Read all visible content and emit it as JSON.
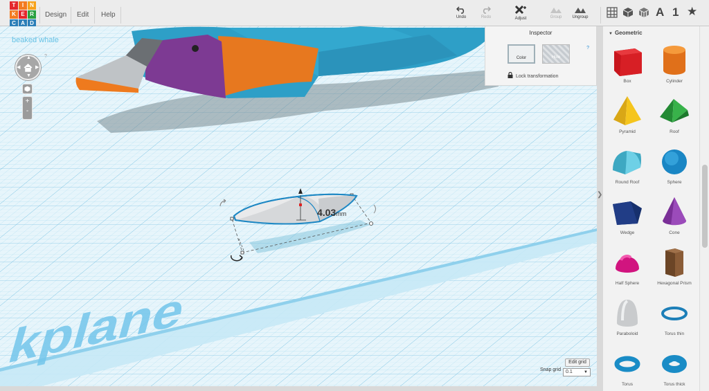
{
  "logo": {
    "letters": [
      "T",
      "I",
      "N",
      "K",
      "E",
      "R",
      "C",
      "A",
      "D"
    ]
  },
  "menu": {
    "design": "Design",
    "edit": "Edit",
    "help": "Help"
  },
  "toolbar": {
    "undo": "Undo",
    "redo": "Redo",
    "adjust": "Adjust",
    "group": "Group",
    "ungroup": "Ungroup"
  },
  "right_tools": {
    "text": "A",
    "number": "1",
    "favorites": "★"
  },
  "document": {
    "title": "beaked whale",
    "help": "?"
  },
  "workplane": {
    "label": "kplane"
  },
  "dimension": {
    "value": "4.03",
    "unit": "mm"
  },
  "grid": {
    "edit_label": "Edit grid",
    "snap_label": "Snap grid",
    "snap_value": "0.1"
  },
  "inspector": {
    "title": "Inspector",
    "color_label": "Color",
    "hole_label": "Hole",
    "help": "?",
    "lock_label": "Lock transformation"
  },
  "panel": {
    "title": "Geometric",
    "shapes": [
      {
        "label": "Box",
        "icon": "box-icon"
      },
      {
        "label": "Cylinder",
        "icon": "cylinder-icon"
      },
      {
        "label": "Pyramid",
        "icon": "pyramid-icon"
      },
      {
        "label": "Roof",
        "icon": "roof-icon"
      },
      {
        "label": "Round Roof",
        "icon": "round-roof-icon"
      },
      {
        "label": "Sphere",
        "icon": "sphere-icon"
      },
      {
        "label": "Wedge",
        "icon": "wedge-icon"
      },
      {
        "label": "Cone",
        "icon": "cone-icon"
      },
      {
        "label": "Half Sphere",
        "icon": "half-sphere-icon"
      },
      {
        "label": "Hexagonal Prism",
        "icon": "hexagonal-prism-icon"
      },
      {
        "label": "Paraboloid",
        "icon": "paraboloid-icon"
      },
      {
        "label": "Torus thin",
        "icon": "torus-thin-icon"
      },
      {
        "label": "Torus",
        "icon": "torus-icon"
      },
      {
        "label": "Torus thick",
        "icon": "torus-thick-icon"
      }
    ]
  },
  "colors": {
    "accent": "#68c3e6",
    "red": "#e4262c",
    "orange": "#f47b20",
    "purple": "#7a3a98",
    "blue": "#2c7fb8",
    "green": "#2aa140"
  }
}
